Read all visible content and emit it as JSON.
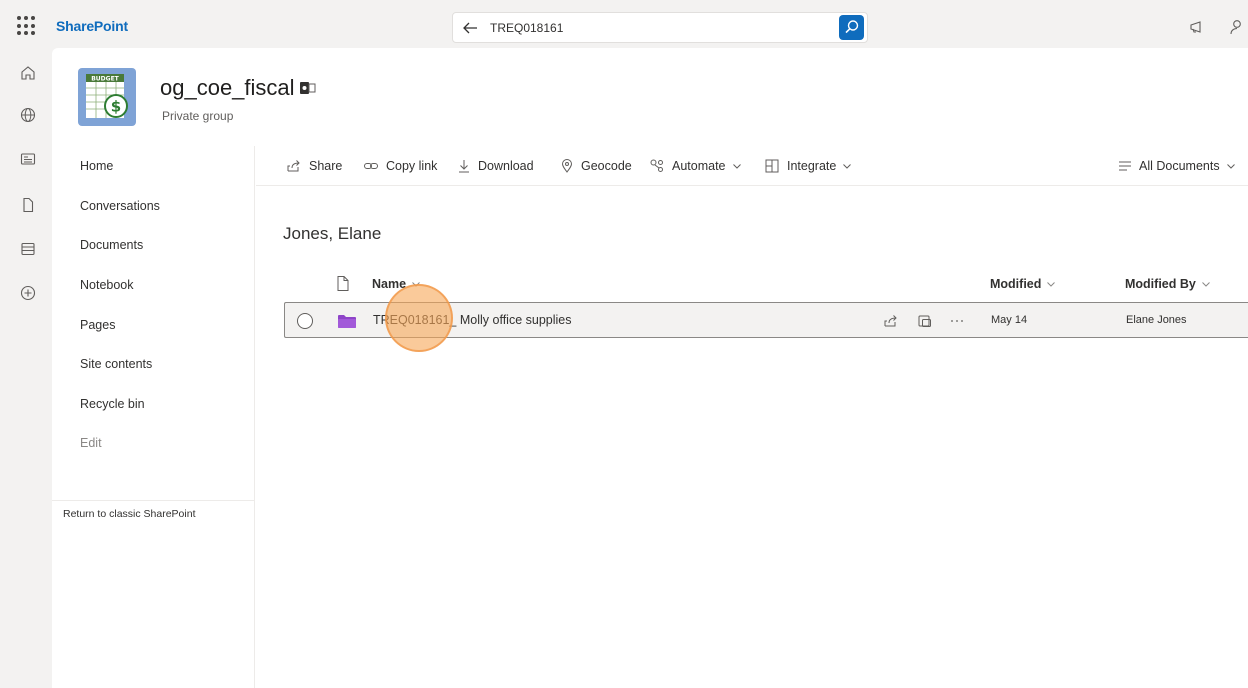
{
  "suite": {
    "brand": "SharePoint",
    "search_value": "TREQ018161"
  },
  "site": {
    "title": "og_coe_fiscal",
    "subtitle": "Private group",
    "logo_text": "BUDGET"
  },
  "leftnav": {
    "items": [
      {
        "label": "Home"
      },
      {
        "label": "Conversations"
      },
      {
        "label": "Documents"
      },
      {
        "label": "Notebook"
      },
      {
        "label": "Pages"
      },
      {
        "label": "Site contents"
      },
      {
        "label": "Recycle bin"
      },
      {
        "label": "Edit"
      }
    ],
    "classic_link": "Return to classic SharePoint"
  },
  "commandbar": {
    "share": "Share",
    "copy_link": "Copy link",
    "download": "Download",
    "geocode": "Geocode",
    "automate": "Automate",
    "integrate": "Integrate",
    "view": "All Documents"
  },
  "content": {
    "folder_title": "Jones, Elane",
    "columns": {
      "name": "Name",
      "modified": "Modified",
      "modified_by": "Modified By"
    },
    "rows": [
      {
        "name": "TREQ018161_ Molly office supplies",
        "modified": "May 14",
        "modified_by": "Elane Jones"
      }
    ]
  },
  "icons": {
    "waffle": "app-launcher-icon",
    "back": "back-arrow-icon",
    "search": "search-icon",
    "megaphone": "megaphone-icon",
    "person": "person-icon",
    "home": "home-icon",
    "globe": "globe-icon",
    "news": "news-icon",
    "file": "file-icon",
    "list": "list-icon",
    "create": "plus-circle-icon",
    "folder": "folder-icon"
  },
  "colors": {
    "brand_blue": "#0f6cbd",
    "folder_purple": "#8e44c8",
    "click_highlight": "#f7a656"
  }
}
